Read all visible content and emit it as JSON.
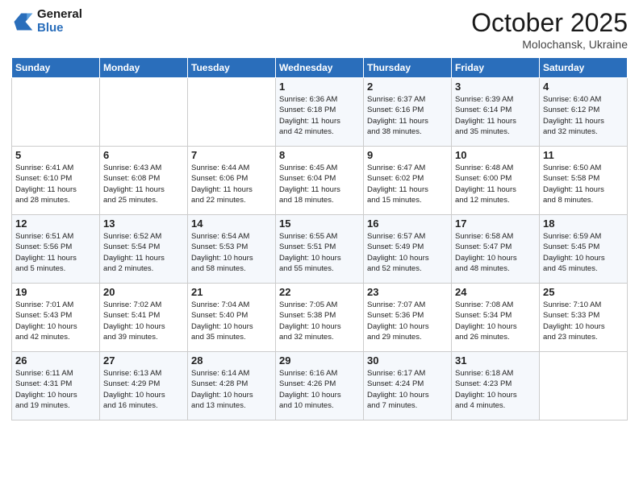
{
  "header": {
    "logo_line1": "General",
    "logo_line2": "Blue",
    "month_title": "October 2025",
    "subtitle": "Molochansk, Ukraine"
  },
  "weekdays": [
    "Sunday",
    "Monday",
    "Tuesday",
    "Wednesday",
    "Thursday",
    "Friday",
    "Saturday"
  ],
  "weeks": [
    [
      {
        "day": "",
        "info": ""
      },
      {
        "day": "",
        "info": ""
      },
      {
        "day": "",
        "info": ""
      },
      {
        "day": "1",
        "info": "Sunrise: 6:36 AM\nSunset: 6:18 PM\nDaylight: 11 hours\nand 42 minutes."
      },
      {
        "day": "2",
        "info": "Sunrise: 6:37 AM\nSunset: 6:16 PM\nDaylight: 11 hours\nand 38 minutes."
      },
      {
        "day": "3",
        "info": "Sunrise: 6:39 AM\nSunset: 6:14 PM\nDaylight: 11 hours\nand 35 minutes."
      },
      {
        "day": "4",
        "info": "Sunrise: 6:40 AM\nSunset: 6:12 PM\nDaylight: 11 hours\nand 32 minutes."
      }
    ],
    [
      {
        "day": "5",
        "info": "Sunrise: 6:41 AM\nSunset: 6:10 PM\nDaylight: 11 hours\nand 28 minutes."
      },
      {
        "day": "6",
        "info": "Sunrise: 6:43 AM\nSunset: 6:08 PM\nDaylight: 11 hours\nand 25 minutes."
      },
      {
        "day": "7",
        "info": "Sunrise: 6:44 AM\nSunset: 6:06 PM\nDaylight: 11 hours\nand 22 minutes."
      },
      {
        "day": "8",
        "info": "Sunrise: 6:45 AM\nSunset: 6:04 PM\nDaylight: 11 hours\nand 18 minutes."
      },
      {
        "day": "9",
        "info": "Sunrise: 6:47 AM\nSunset: 6:02 PM\nDaylight: 11 hours\nand 15 minutes."
      },
      {
        "day": "10",
        "info": "Sunrise: 6:48 AM\nSunset: 6:00 PM\nDaylight: 11 hours\nand 12 minutes."
      },
      {
        "day": "11",
        "info": "Sunrise: 6:50 AM\nSunset: 5:58 PM\nDaylight: 11 hours\nand 8 minutes."
      }
    ],
    [
      {
        "day": "12",
        "info": "Sunrise: 6:51 AM\nSunset: 5:56 PM\nDaylight: 11 hours\nand 5 minutes."
      },
      {
        "day": "13",
        "info": "Sunrise: 6:52 AM\nSunset: 5:54 PM\nDaylight: 11 hours\nand 2 minutes."
      },
      {
        "day": "14",
        "info": "Sunrise: 6:54 AM\nSunset: 5:53 PM\nDaylight: 10 hours\nand 58 minutes."
      },
      {
        "day": "15",
        "info": "Sunrise: 6:55 AM\nSunset: 5:51 PM\nDaylight: 10 hours\nand 55 minutes."
      },
      {
        "day": "16",
        "info": "Sunrise: 6:57 AM\nSunset: 5:49 PM\nDaylight: 10 hours\nand 52 minutes."
      },
      {
        "day": "17",
        "info": "Sunrise: 6:58 AM\nSunset: 5:47 PM\nDaylight: 10 hours\nand 48 minutes."
      },
      {
        "day": "18",
        "info": "Sunrise: 6:59 AM\nSunset: 5:45 PM\nDaylight: 10 hours\nand 45 minutes."
      }
    ],
    [
      {
        "day": "19",
        "info": "Sunrise: 7:01 AM\nSunset: 5:43 PM\nDaylight: 10 hours\nand 42 minutes."
      },
      {
        "day": "20",
        "info": "Sunrise: 7:02 AM\nSunset: 5:41 PM\nDaylight: 10 hours\nand 39 minutes."
      },
      {
        "day": "21",
        "info": "Sunrise: 7:04 AM\nSunset: 5:40 PM\nDaylight: 10 hours\nand 35 minutes."
      },
      {
        "day": "22",
        "info": "Sunrise: 7:05 AM\nSunset: 5:38 PM\nDaylight: 10 hours\nand 32 minutes."
      },
      {
        "day": "23",
        "info": "Sunrise: 7:07 AM\nSunset: 5:36 PM\nDaylight: 10 hours\nand 29 minutes."
      },
      {
        "day": "24",
        "info": "Sunrise: 7:08 AM\nSunset: 5:34 PM\nDaylight: 10 hours\nand 26 minutes."
      },
      {
        "day": "25",
        "info": "Sunrise: 7:10 AM\nSunset: 5:33 PM\nDaylight: 10 hours\nand 23 minutes."
      }
    ],
    [
      {
        "day": "26",
        "info": "Sunrise: 6:11 AM\nSunset: 4:31 PM\nDaylight: 10 hours\nand 19 minutes."
      },
      {
        "day": "27",
        "info": "Sunrise: 6:13 AM\nSunset: 4:29 PM\nDaylight: 10 hours\nand 16 minutes."
      },
      {
        "day": "28",
        "info": "Sunrise: 6:14 AM\nSunset: 4:28 PM\nDaylight: 10 hours\nand 13 minutes."
      },
      {
        "day": "29",
        "info": "Sunrise: 6:16 AM\nSunset: 4:26 PM\nDaylight: 10 hours\nand 10 minutes."
      },
      {
        "day": "30",
        "info": "Sunrise: 6:17 AM\nSunset: 4:24 PM\nDaylight: 10 hours\nand 7 minutes."
      },
      {
        "day": "31",
        "info": "Sunrise: 6:18 AM\nSunset: 4:23 PM\nDaylight: 10 hours\nand 4 minutes."
      },
      {
        "day": "",
        "info": ""
      }
    ]
  ]
}
